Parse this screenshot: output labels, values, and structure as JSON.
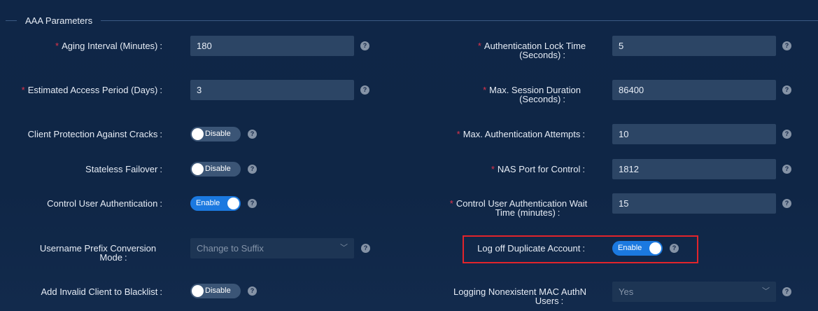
{
  "section": {
    "title": "AAA Parameters"
  },
  "fields": {
    "aging_interval": {
      "label": "Aging Interval (Minutes)",
      "value": "180"
    },
    "auth_lock_time": {
      "label_line1": "Authentication Lock Time",
      "label_line2": "(Seconds)",
      "value": "5"
    },
    "estimated_access_period": {
      "label": "Estimated Access Period (Days)",
      "value": "3"
    },
    "max_session_duration": {
      "label_line1": "Max. Session Duration",
      "label_line2": "(Seconds)",
      "value": "86400"
    },
    "client_protection": {
      "label": "Client Protection Against Cracks",
      "toggle": "Disable"
    },
    "max_auth_attempts": {
      "label": "Max. Authentication Attempts",
      "value": "10"
    },
    "stateless_failover": {
      "label": "Stateless Failover",
      "toggle": "Disable"
    },
    "nas_port": {
      "label": "NAS Port for Control",
      "value": "1812"
    },
    "control_user_auth": {
      "label": "Control User Authentication",
      "toggle": "Enable"
    },
    "control_user_wait": {
      "label_line1": "Control User Authentication Wait",
      "label_line2": "Time (minutes)",
      "value": "15"
    },
    "username_prefix": {
      "label_line1": "Username Prefix Conversion",
      "label_line2": "Mode",
      "value": "Change to Suffix"
    },
    "log_off_duplicate": {
      "label": "Log off Duplicate Account",
      "toggle": "Enable"
    },
    "add_invalid_client": {
      "label": "Add Invalid Client to Blacklist",
      "toggle": "Disable"
    },
    "logging_nonexistent_mac": {
      "label_line1": "Logging Nonexistent MAC AuthN",
      "label_line2": "Users",
      "value": "Yes"
    }
  },
  "common": {
    "colon": ":",
    "required_mark": "*",
    "help_glyph": "?",
    "chevron": "﹀"
  }
}
